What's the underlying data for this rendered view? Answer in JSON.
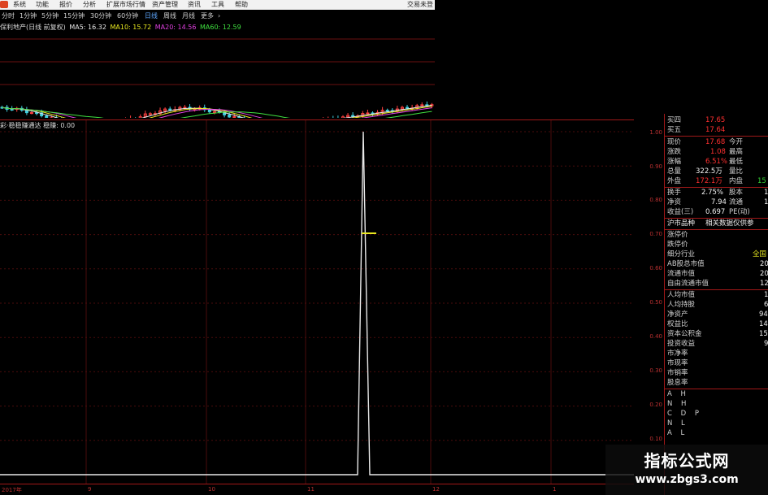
{
  "menu": {
    "items": [
      "系统",
      "功能",
      "报价",
      "分析",
      "扩展市场行情",
      "资产管理",
      "资讯",
      "工具",
      "帮助"
    ],
    "right_label": "交易未登"
  },
  "periods": {
    "items": [
      "分时",
      "1分钟",
      "5分钟",
      "15分钟",
      "30分钟",
      "60分钟",
      "日线",
      "周线",
      "月线",
      "更多"
    ],
    "active": "日线",
    "more_arrow": "›"
  },
  "main_chart": {
    "legend_name": "保利地产(日线 前复权)",
    "ma": [
      {
        "label": "MA5: 16.32",
        "color": "#e8e8e8"
      },
      {
        "label": "MA10: 15.72",
        "color": "#e8e820"
      },
      {
        "label": "MA20: 14.56",
        "color": "#e040e0"
      },
      {
        "label": "MA60: 12.59",
        "color": "#40e040"
      }
    ]
  },
  "indicator": {
    "title": "彩·稳稳赚通达 稳赚: 0.00",
    "y_ticks": [
      "1.00",
      "0.90",
      "0.80",
      "0.70",
      "0.60",
      "0.50",
      "0.40",
      "0.30",
      "0.20",
      "0.10"
    ],
    "x_ticks": [
      "2017年",
      "9",
      "10",
      "11",
      "12",
      "1"
    ],
    "ylim": [
      0,
      1
    ],
    "spike_value": 1.0
  },
  "quote": {
    "buy4": {
      "label": "买四",
      "value": "17.65"
    },
    "buy5": {
      "label": "买五",
      "value": "17.64"
    },
    "price": {
      "label": "现价",
      "value": "17.68",
      "label2": "今开"
    },
    "change": {
      "label": "涨跌",
      "value": "1.08",
      "label2": "最高"
    },
    "pct": {
      "label": "涨幅",
      "value": "6.51%",
      "label2": "最低"
    },
    "volume": {
      "label": "总量",
      "value": "322.5万",
      "label2": "量比"
    },
    "outer": {
      "label": "外盘",
      "value": "172.1万",
      "label2": "内盘",
      "value2": "15"
    },
    "turnover": {
      "label": "换手",
      "value": "2.75%",
      "label2": "股本",
      "value2": "1"
    },
    "net_asset": {
      "label": "净资",
      "value": "7.94",
      "label2": "流通",
      "value2": "1"
    },
    "eps": {
      "label": "收益(三)",
      "value": "0.697",
      "label2": "PE(动)"
    },
    "hk_link": {
      "label": "沪市品种",
      "label2": "相关数据仅供参"
    },
    "limit_up": "涨停价",
    "limit_down": "跌停价",
    "industry": {
      "label": "细分行业",
      "value": "全国"
    },
    "ab_cap": {
      "label": "AB股总市值",
      "value": "20"
    },
    "float_cap": {
      "label": "流通市值",
      "value": "20"
    },
    "free_cap": {
      "label": "自由流通市值",
      "value": "12"
    },
    "per_cap": {
      "label": "人均市值",
      "value": "1"
    },
    "per_hold": {
      "label": "人均持股",
      "value": "6"
    },
    "assets": {
      "label": "净资产",
      "value": "94"
    },
    "equity_ratio": {
      "label": "权益比",
      "value": "14"
    },
    "reserve": {
      "label": "资本公积金",
      "value": "15"
    },
    "invest": {
      "label": "投资收益",
      "value": "9"
    },
    "pb": "市净率",
    "pcf": "市现率",
    "ps": "市销率",
    "dividend": "股息率",
    "ah_codes": [
      "A H",
      "N H",
      "C D P",
      "N L",
      "A L"
    ]
  },
  "watermark": {
    "title": "指标公式网",
    "url": "www.zbgs3.com"
  }
}
